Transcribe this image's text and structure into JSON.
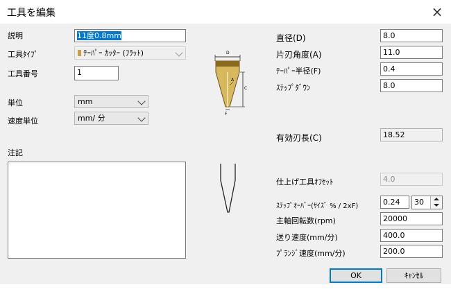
{
  "window": {
    "title": "工具を編集",
    "close_icon": "×"
  },
  "left": {
    "description_label": "説明",
    "description_value": "11度0.8mm",
    "tool_type_label": "工具ﾀｲﾌﾟ",
    "tool_type_value": "ﾃｰﾊﾟｰ ｶｯﾀｰ (ﾌﾗｯﾄ)",
    "tool_number_label": "工具番号",
    "tool_number_value": "1",
    "unit_label": "単位",
    "unit_value": "mm",
    "speed_unit_label": "速度単位",
    "speed_unit_value": "mm/ 分",
    "notes_label": "注記",
    "notes_value": ""
  },
  "diagram": {
    "label_d": "D",
    "label_a": "A",
    "label_c": "C",
    "label_f": "F"
  },
  "right": {
    "diameter_label": "直径(D)",
    "diameter_value": "8.0",
    "half_angle_label": "片刃角度(A)",
    "half_angle_value": "11.0",
    "taper_radius_label": "ﾃｰﾊﾟｰ半径(F)",
    "taper_radius_value": "0.4",
    "stepdown_label": "ｽﾃｯﾌﾟﾀﾞｳﾝ",
    "stepdown_value": "8.0",
    "effective_length_label": "有効刃長(C)",
    "effective_length_value": "18.52",
    "finish_offset_label": "仕上げ工具ｵﾌｾｯﾄ",
    "finish_offset_value": "4.0",
    "stepover_label": "ｽﾃｯﾌﾟｵｰﾊﾞｰ(ｻｲｽﾞ % / 2xF)",
    "stepover_value": "0.24",
    "stepover_percent": "30",
    "spindle_label": "主軸回転数(rpm)",
    "spindle_value": "20000",
    "feed_label": "送り速度(mm/分)",
    "feed_value": "400.0",
    "plunge_label": "ﾌﾟﾗﾝｼﾞ速度(mm/分)",
    "plunge_value": "200.0"
  },
  "buttons": {
    "ok_label": "OK",
    "cancel_label": "ｷｬﾝｾﾙ"
  },
  "colors": {
    "accent": "#0078d7",
    "dialog_bg": "#f0f0f0",
    "tool_gold": "#d7b85c"
  }
}
